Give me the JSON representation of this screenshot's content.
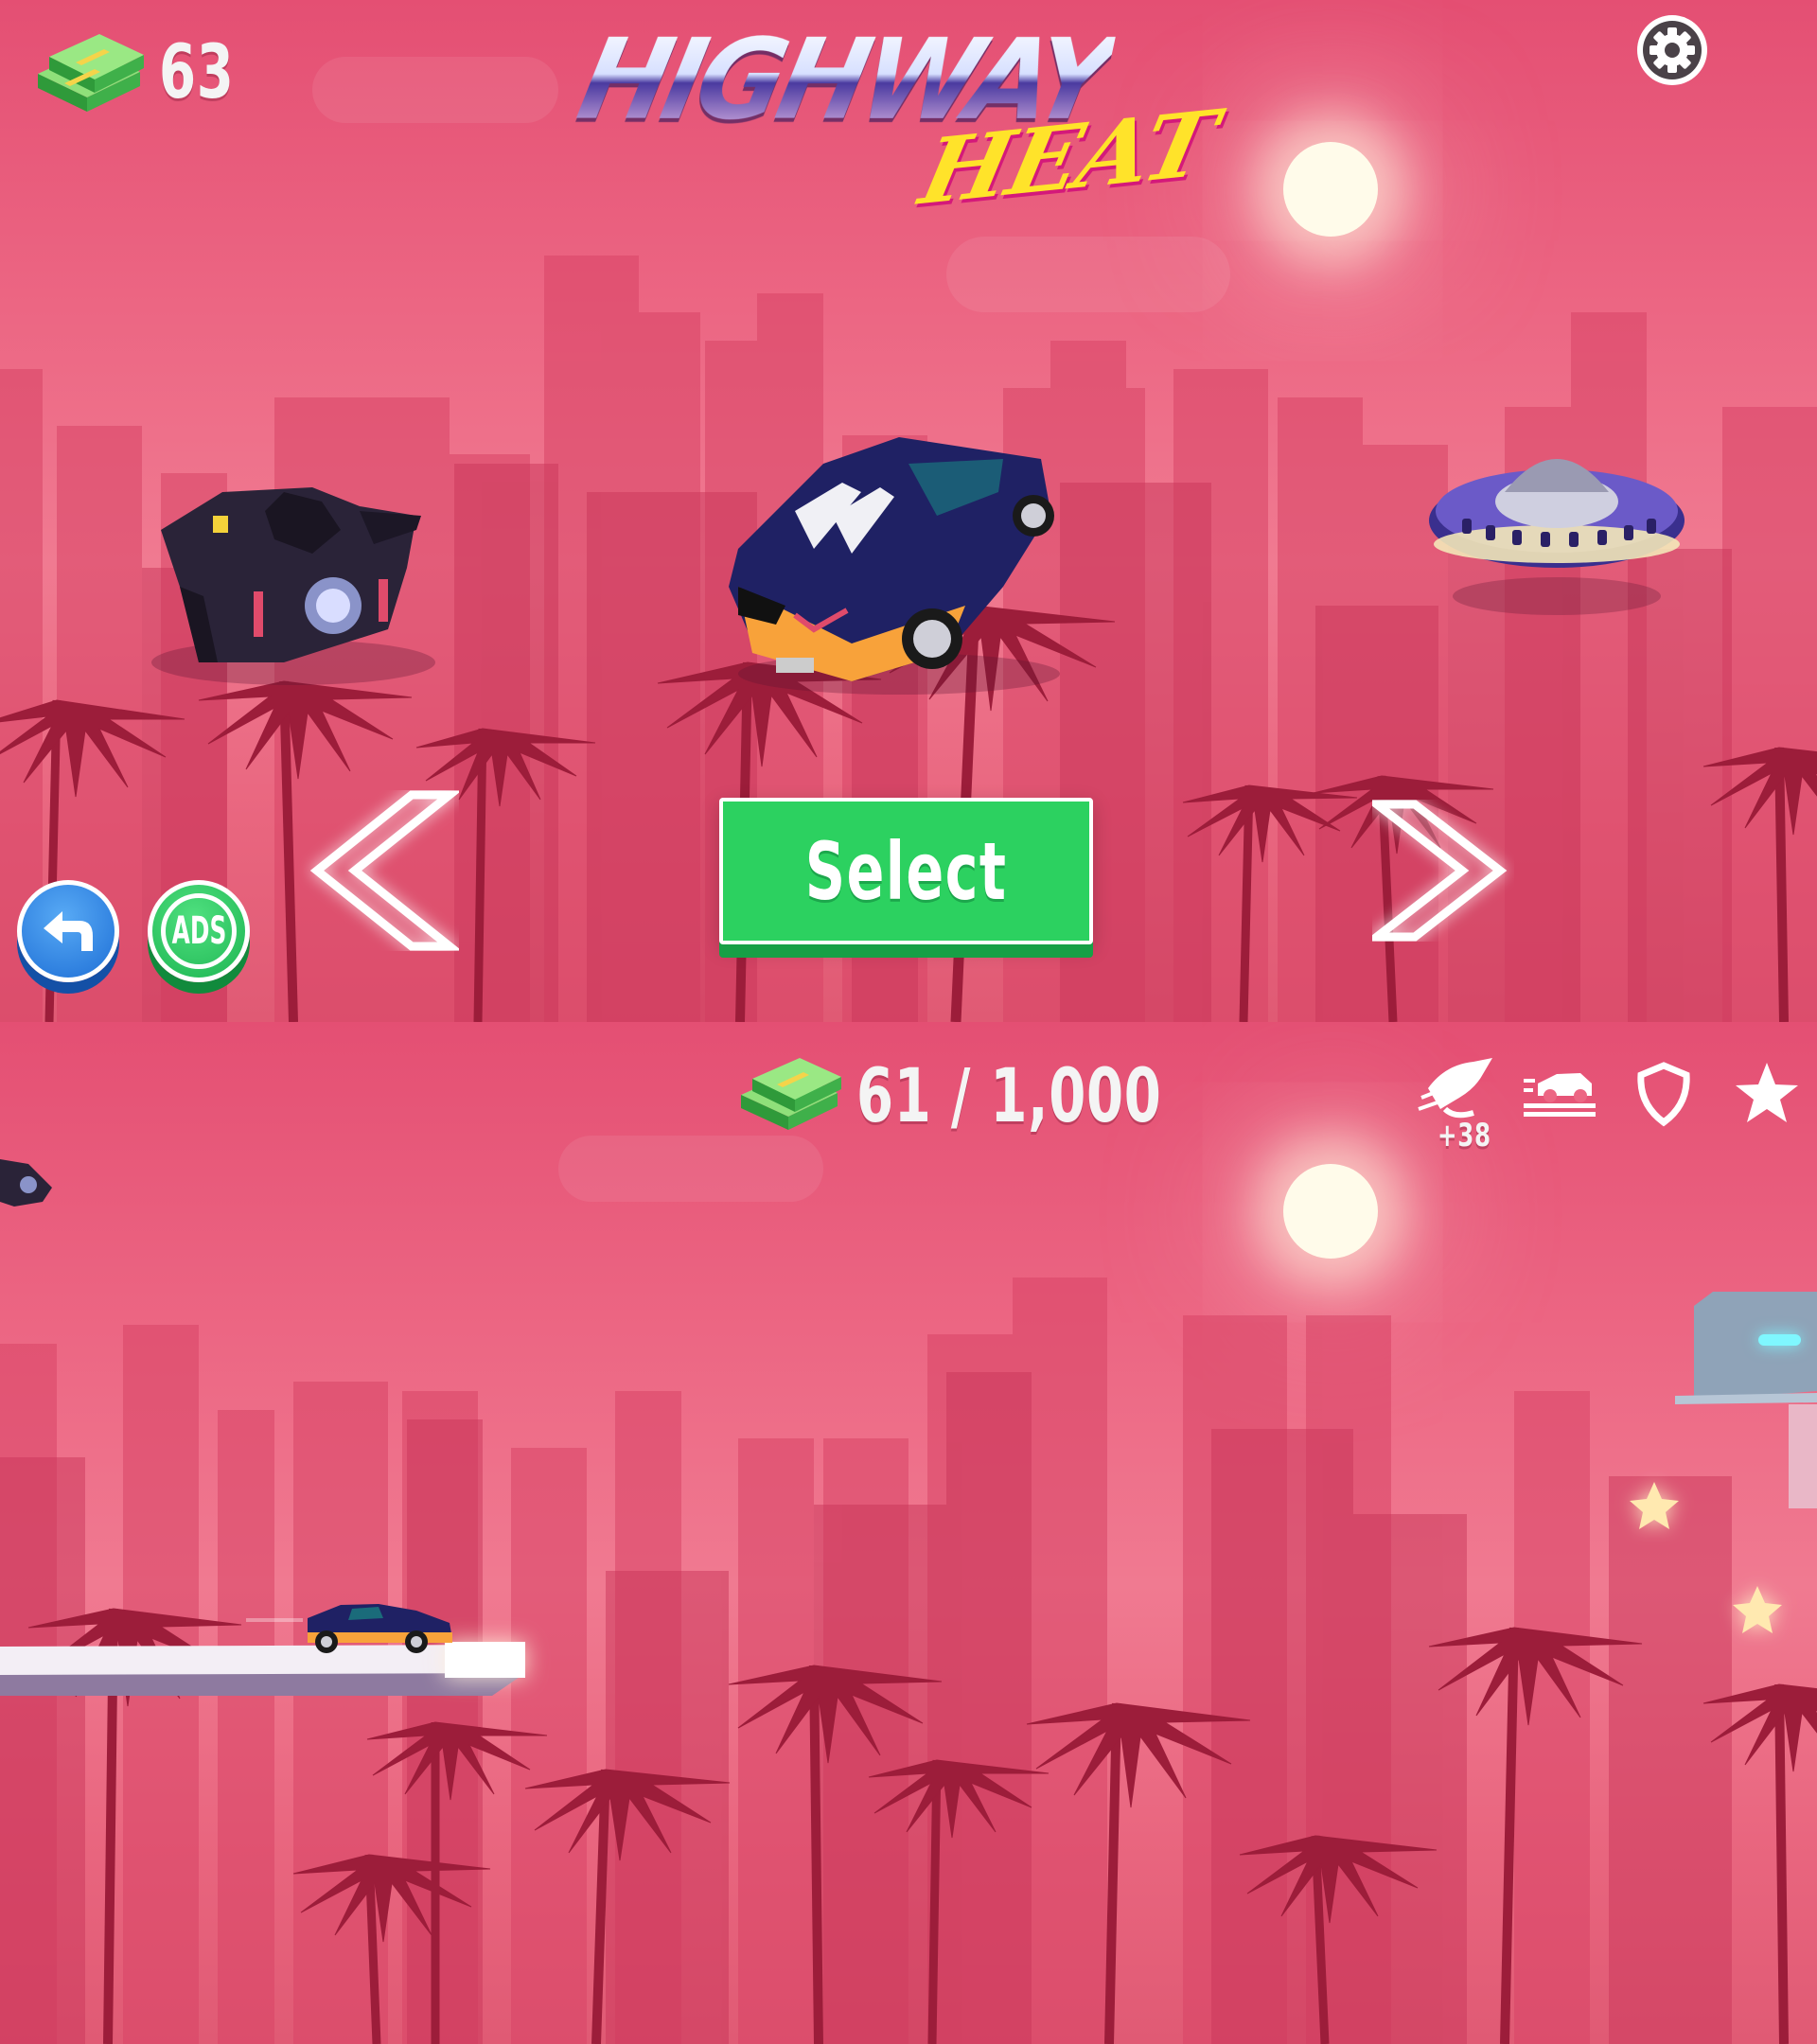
{
  "top_screen": {
    "cash": "63",
    "logo_line1": "HIGHWAY",
    "logo_line2": "HEAT",
    "select_label": "Select",
    "vehicles": [
      "bat-car",
      "hypercar",
      "ufo"
    ],
    "colors": {
      "sky": "#ec6683",
      "select_button": "#2cd160",
      "back_button": "#1e6fd6",
      "ads_button": "#1db552",
      "logo_yellow": "#ffe32a"
    }
  },
  "bottom_screen": {
    "cash_progress": "61 / 1,000",
    "boost_bonus": "+38",
    "powerups": [
      "boost-icon",
      "car-speed-icon",
      "shield-icon",
      "star-icon"
    ]
  },
  "ads_label": "ADS"
}
